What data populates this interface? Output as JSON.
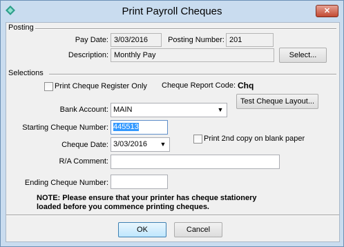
{
  "window": {
    "title": "Print Payroll Cheques",
    "close_label": "✕"
  },
  "posting": {
    "group_label": "Posting",
    "pay_date_label": "Pay Date:",
    "pay_date_value": "3/03/2016",
    "posting_number_label": "Posting Number:",
    "posting_number_value": "201",
    "description_label": "Description:",
    "description_value": "Monthly Pay",
    "select_button": "Select..."
  },
  "selections": {
    "group_label": "Selections",
    "print_register_only_label": "Print Cheque Register Only",
    "print_register_only_checked": false,
    "cheque_report_code_label": "Cheque Report Code:",
    "cheque_report_code_value": "Chq",
    "test_layout_button": "Test Cheque Layout...",
    "bank_account_label": "Bank Account:",
    "bank_account_value": "MAIN",
    "starting_cheque_label": "Starting Cheque Number:",
    "starting_cheque_value": "445513",
    "cheque_date_label": "Cheque Date:",
    "cheque_date_value": "3/03/2016",
    "print_2nd_copy_label": "Print 2nd copy on blank paper",
    "print_2nd_copy_checked": false,
    "ra_comment_label": "R/A Comment:",
    "ra_comment_value": "",
    "ending_cheque_label": "Ending Cheque Number:",
    "ending_cheque_value": "",
    "note_line1": "NOTE: Please ensure that your printer has cheque stationery",
    "note_line2": "loaded before you commence printing cheques."
  },
  "footer": {
    "ok_label": "OK",
    "cancel_label": "Cancel"
  },
  "colors": {
    "frame": "#c9dcef",
    "client": "#f0f0f0",
    "selection": "#3399ff",
    "close": "#c24a33"
  }
}
